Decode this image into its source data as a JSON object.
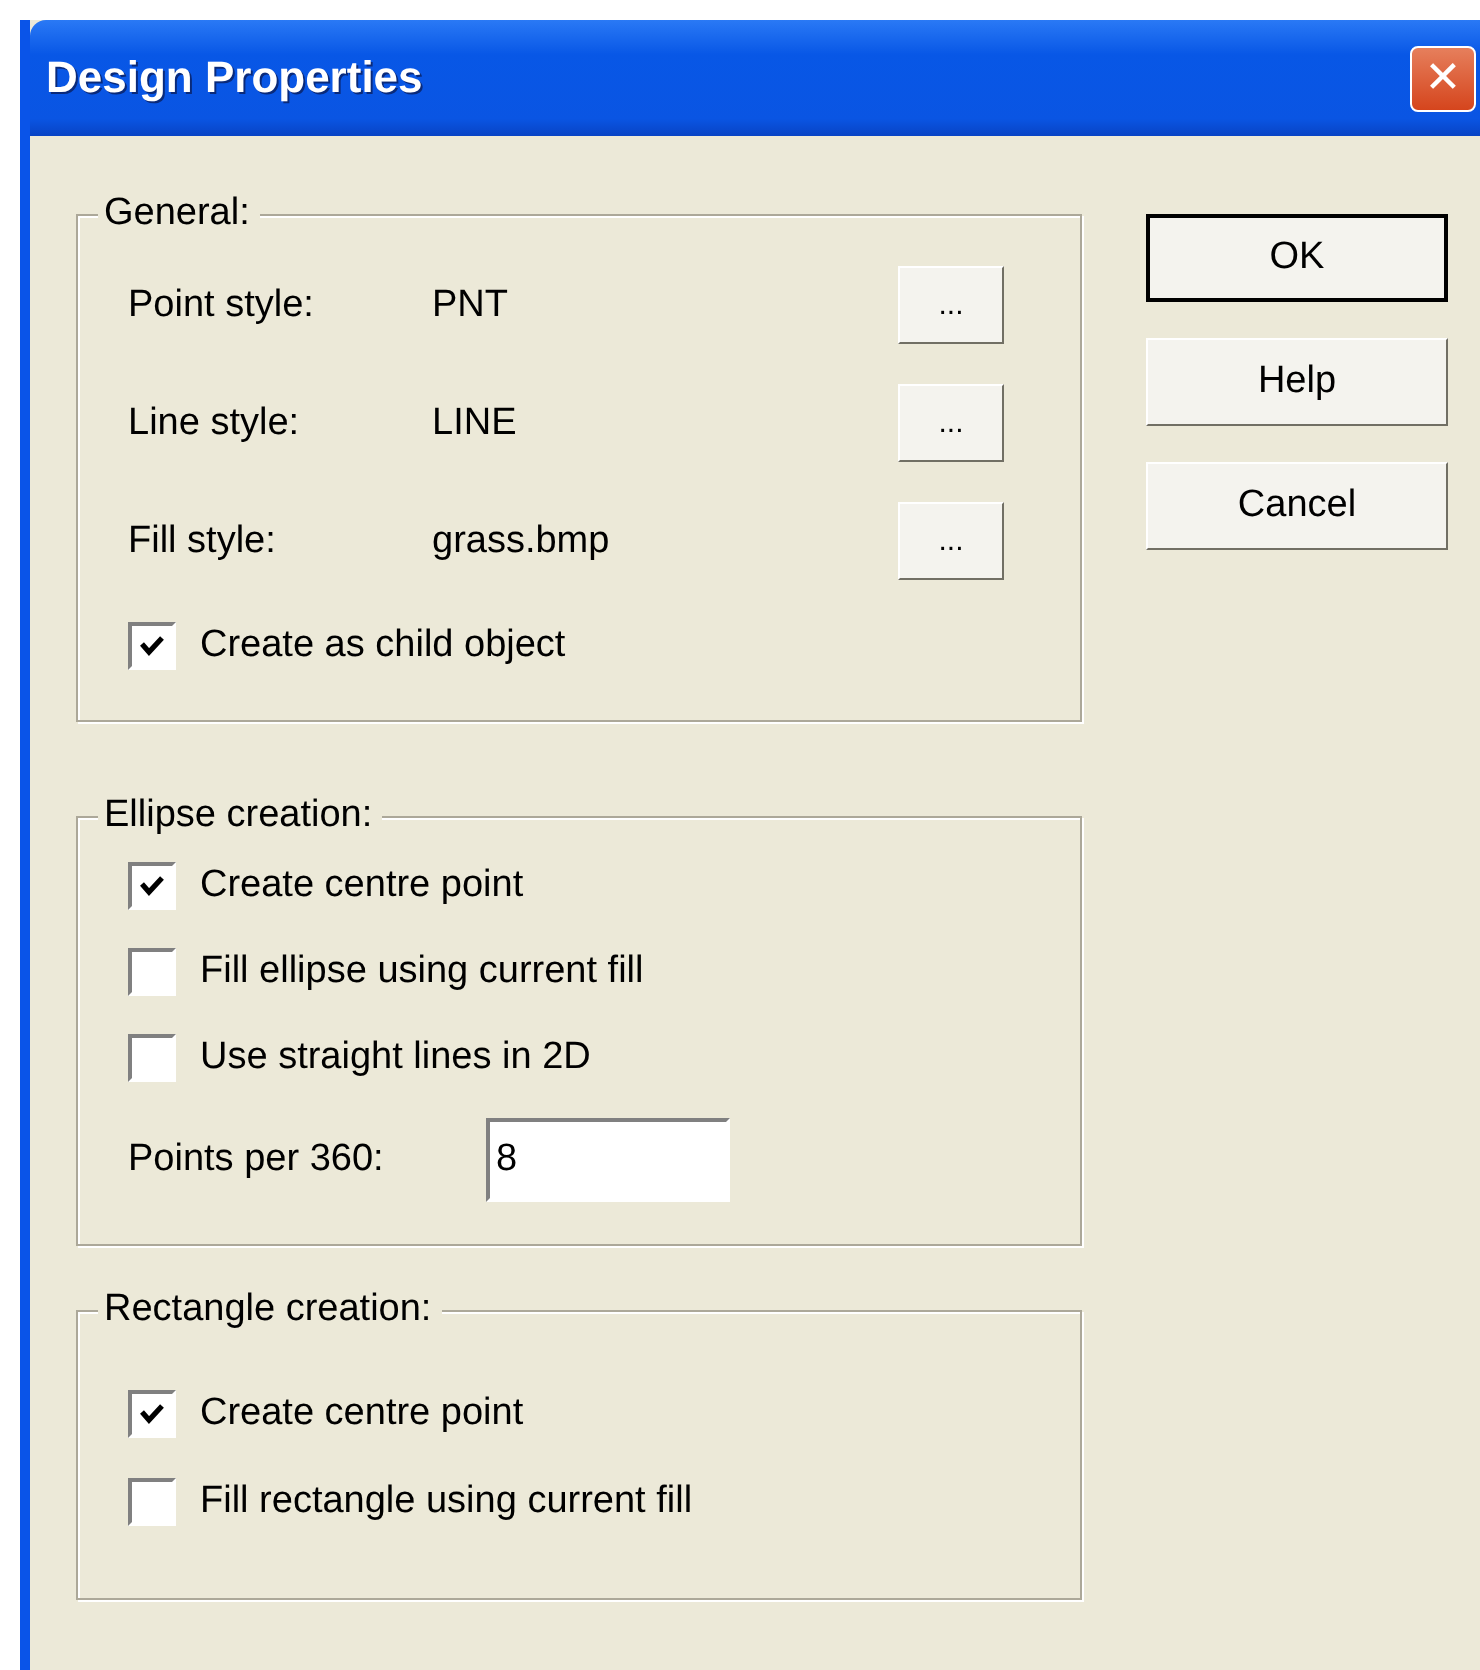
{
  "window": {
    "title": "Design Properties",
    "close": "✕"
  },
  "groups": [
    {
      "title": "General:",
      "items": [
        {
          "kind": "style",
          "label": "Point style:",
          "value": "PNT",
          "button": "..."
        },
        {
          "kind": "style",
          "label": "Line style:",
          "value": "LINE",
          "button": "..."
        },
        {
          "kind": "style",
          "label": "Fill style:",
          "value": "grass.bmp",
          "button": "..."
        },
        {
          "kind": "checkbox",
          "label": "Create as child object",
          "checked": true
        }
      ]
    },
    {
      "title": "Ellipse creation:",
      "items": [
        {
          "kind": "checkbox",
          "label": "Create centre point",
          "checked": true
        },
        {
          "kind": "checkbox",
          "label": "Fill ellipse using current fill",
          "checked": false
        },
        {
          "kind": "checkbox",
          "label": "Use straight lines in 2D",
          "checked": false
        },
        {
          "kind": "number",
          "label": "Points per 360:",
          "value": "8"
        }
      ]
    },
    {
      "title": "Rectangle creation:",
      "items": [
        {
          "kind": "checkbox",
          "label": "Create centre point",
          "checked": true
        },
        {
          "kind": "checkbox",
          "label": "Fill rectangle using current fill",
          "checked": false
        }
      ]
    }
  ],
  "buttons": [
    {
      "label": "OK",
      "default": true
    },
    {
      "label": "Help",
      "default": false
    },
    {
      "label": "Cancel",
      "default": false
    }
  ]
}
